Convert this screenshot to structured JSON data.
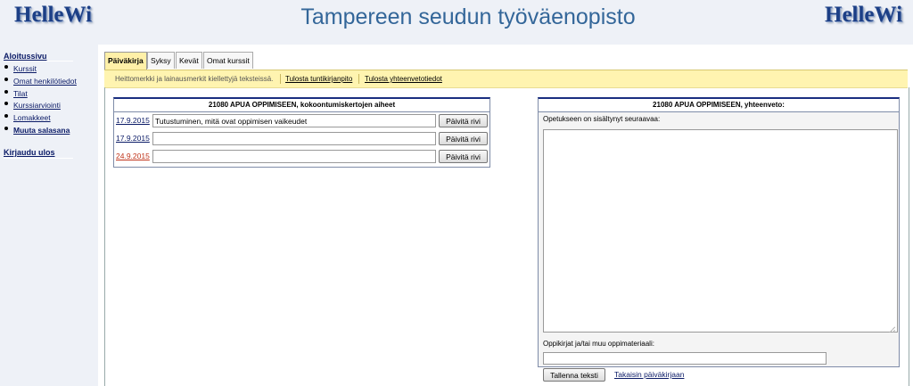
{
  "header": {
    "logo_left": "HelleWi",
    "title": "Tampereen seudun työväenopisto",
    "logo_right": "HelleWi"
  },
  "sidebar": {
    "home": "Aloitussivu",
    "items": [
      {
        "label": "Kurssit"
      },
      {
        "label": "Omat henkilötiedot"
      },
      {
        "label": "Tilat"
      },
      {
        "label": "Kurssiarviointi"
      },
      {
        "label": "Lomakkeet"
      },
      {
        "label": "Muuta salasana"
      }
    ],
    "logout": "Kirjaudu ulos"
  },
  "tabs": [
    {
      "label": "Päiväkirja",
      "active": true
    },
    {
      "label": "Syksy"
    },
    {
      "label": "Kevät"
    },
    {
      "label": "Omat kurssit"
    }
  ],
  "infobar": {
    "notice": "Heittomerkki ja lainausmerkit kiellettyjä teksteissä.",
    "print_hours": "Tulosta tuntikirjanpito",
    "print_summary": "Tulosta yhteenvetotiedot"
  },
  "left_panel": {
    "title": "21080 APUA OPPIMISEEN, kokoontumiskertojen aiheet",
    "rows": [
      {
        "date": "17.9.2015",
        "topic": "Tutustuminen, mitä ovat oppimisen vaikeudet",
        "button": "Päivitä rivi"
      },
      {
        "date": "17.9.2015",
        "topic": "",
        "button": "Päivitä rivi"
      },
      {
        "date": "24.9.2015",
        "topic": "",
        "button": "Päivitä rivi"
      }
    ]
  },
  "right_panel": {
    "title": "21080 APUA OPPIMISEEN,  yhteenveto:",
    "content_label": "Opetukseen on sisältynyt seuraavaa:",
    "content_value": "",
    "materials_label": "Oppikirjat ja/tai muu oppimateriaali:",
    "materials_value": "",
    "save_button": "Tallenna teksti",
    "back_link": "Takaisin päiväkirjaan"
  }
}
